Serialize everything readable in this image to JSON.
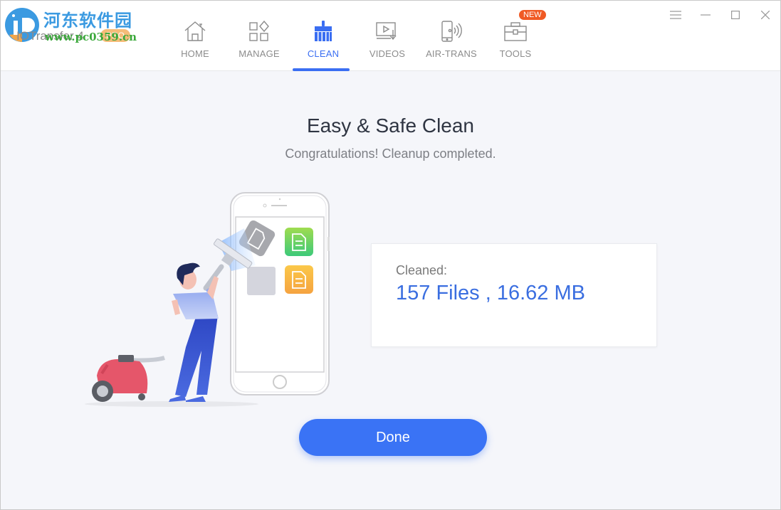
{
  "brand": {
    "watermark_cn": "河东软件园",
    "watermark_url": "www.pc0359.cn",
    "app_name": "IOTransfer 4",
    "edition_badge": "PRO"
  },
  "nav": {
    "items": [
      {
        "label": "HOME",
        "icon": "home-icon",
        "active": false
      },
      {
        "label": "MANAGE",
        "icon": "manage-grid-icon",
        "active": false
      },
      {
        "label": "CLEAN",
        "icon": "broom-icon",
        "active": true
      },
      {
        "label": "VIDEOS",
        "icon": "video-download-icon",
        "active": false
      },
      {
        "label": "AIR-TRANS",
        "icon": "phone-wireless-icon",
        "active": false
      },
      {
        "label": "TOOLS",
        "icon": "toolbox-icon",
        "active": false,
        "badge": "NEW"
      }
    ]
  },
  "window_controls": [
    "menu-icon",
    "minimize-icon",
    "maximize-icon",
    "close-icon"
  ],
  "main": {
    "title": "Easy & Safe Clean",
    "subtitle": "Congratulations! Cleanup completed.",
    "result": {
      "label": "Cleaned:",
      "value": "157 Files , 16.62 MB",
      "files": 157,
      "size": "16.62 MB"
    },
    "done_button": "Done"
  },
  "colors": {
    "accent": "#3a6ef2",
    "button": "#3a73f5",
    "badge_new": "#f05a24",
    "background": "#f5f6fa"
  }
}
